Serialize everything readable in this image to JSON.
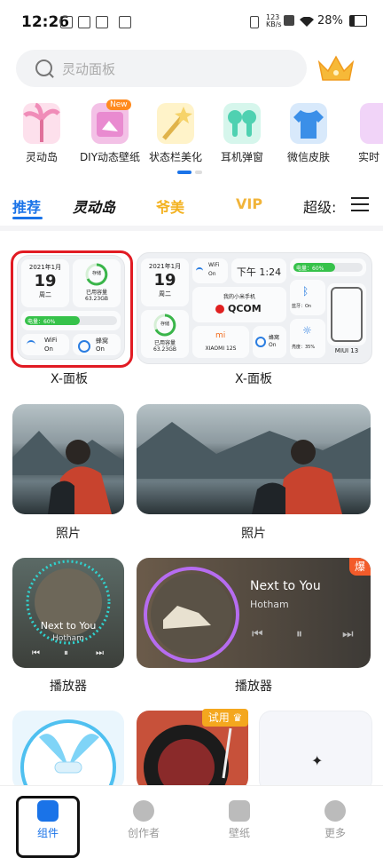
{
  "status_bar": {
    "time": "12:26",
    "net_speed": "123\nKB/s",
    "battery": "28%"
  },
  "search": {
    "placeholder": "灵动面板"
  },
  "categories": [
    {
      "label": "灵动岛",
      "icon": "palm-tree-icon",
      "color": "#f7a6c8"
    },
    {
      "label": "DIY动态壁纸",
      "icon": "dynamic-wallpaper-icon",
      "color": "#e98bd0"
    },
    {
      "label": "状态栏美化",
      "icon": "magic-wand-icon",
      "color": "#f6d36a"
    },
    {
      "label": "耳机弹窗",
      "icon": "earbuds-icon",
      "color": "#4fd1b1"
    },
    {
      "label": "微信皮肤",
      "icon": "tshirt-icon",
      "color": "#3b8fe8"
    },
    {
      "label": "实时",
      "icon": "partial-icon",
      "color": "#e6a8f2"
    }
  ],
  "new_badge": "New",
  "tabs": [
    {
      "label": "推荐",
      "active": true
    },
    {
      "label": "灵动岛",
      "active": false
    },
    {
      "label": "爷美",
      "active": false
    },
    {
      "label": "VIP",
      "active": false
    },
    {
      "label": "超级:",
      "active": false
    }
  ],
  "xpanel_small": {
    "date": "2021年1月",
    "day": "19",
    "weekday": "周二",
    "storage_title": "存储",
    "storage_used": "已用容量",
    "storage_size": "63.23GB",
    "battery_text": "电量：60%",
    "battery_pct": 0.6,
    "wifi": "WiFi",
    "wifi_state": "On",
    "cell": "蜂窝",
    "cell_state": "On"
  },
  "xpanel_large": {
    "date": "2021年1月",
    "day": "19",
    "weekday": "周二",
    "wifi": "WiFi",
    "wifi_state": "On",
    "clock": "下午 1:24",
    "battery_text": "电量：60%",
    "phone_name": "我的小米手机",
    "brand": "QCOM",
    "bt": "蓝牙：On",
    "storage_title": "存储",
    "storage_used": "已用容量",
    "storage_size": "63.23GB",
    "xiaomi": "XIAOMI 12S",
    "cell": "蜂窝",
    "cell_state": "On",
    "brightness": "亮度：35%",
    "miui": "MIUI 13"
  },
  "captions": {
    "xpanel1": "X-面板",
    "xpanel2": "X-面板",
    "photo1": "照片",
    "photo2": "照片",
    "player1": "播放器",
    "player2": "播放器"
  },
  "player_small": {
    "title": "Next to You",
    "artist": "Hotham"
  },
  "player_large": {
    "title": "Next to You",
    "artist": "Hotham",
    "badge": "爆"
  },
  "trial_badge": "试用",
  "bottom_nav": [
    {
      "label": "组件",
      "active": true
    },
    {
      "label": "创作者",
      "active": false
    },
    {
      "label": "壁纸",
      "active": false
    },
    {
      "label": "更多",
      "active": false
    }
  ]
}
